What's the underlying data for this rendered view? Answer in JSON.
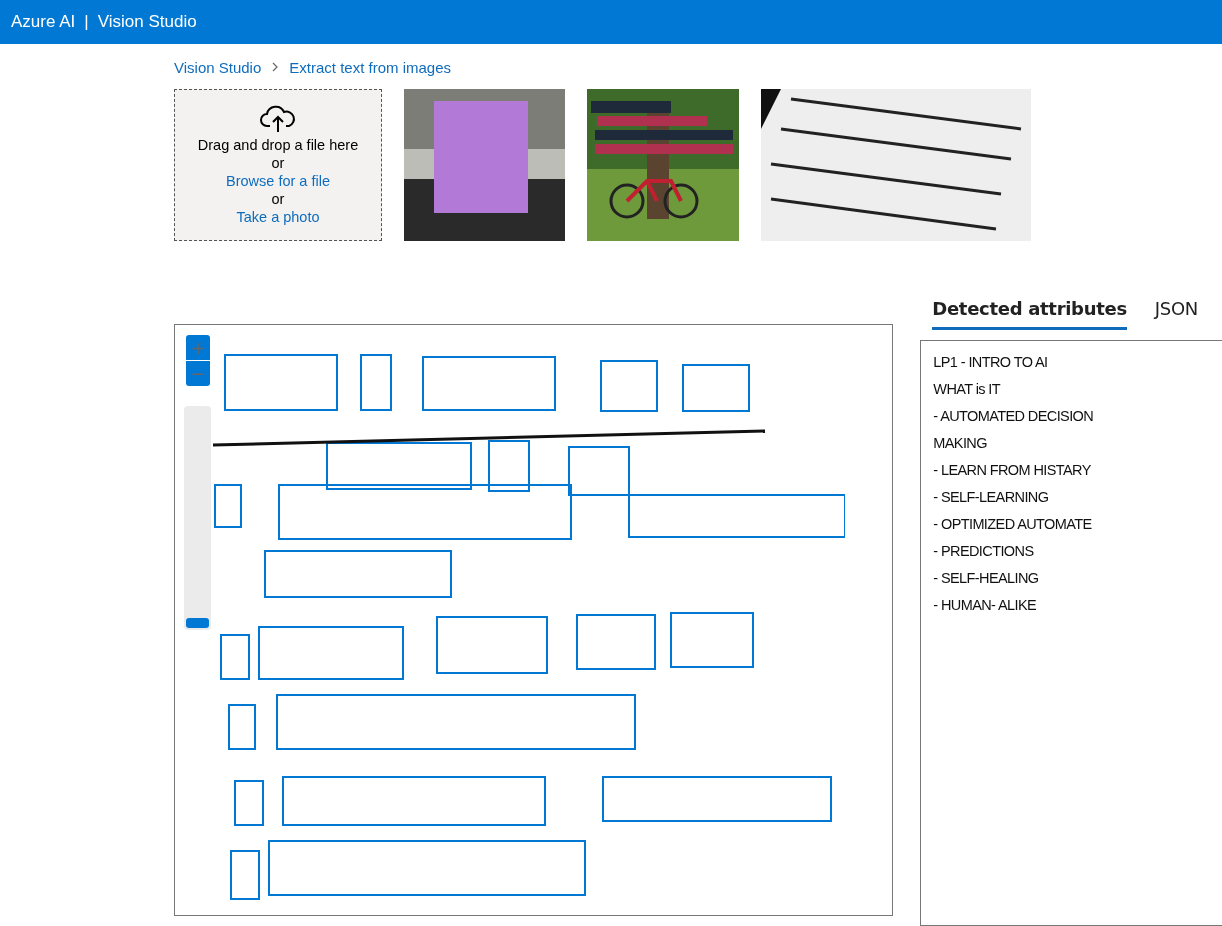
{
  "header": {
    "product": "Azure AI",
    "separator": "|",
    "title": "Vision Studio"
  },
  "breadcrumb": [
    {
      "label": "Vision Studio"
    },
    {
      "label": "Extract text from images"
    }
  ],
  "upload": {
    "prompt": "Drag and drop a file here",
    "or_1": "or",
    "browse": "Browse for a file",
    "or_2": "or",
    "photo": "Take a photo"
  },
  "samples": [
    {
      "kind": "note"
    },
    {
      "kind": "bicycle"
    },
    {
      "kind": "label"
    }
  ],
  "viewer": {
    "zoom_in": "+",
    "zoom_out": "−",
    "zoom": {
      "level": 0
    }
  },
  "tabs": [
    {
      "label": "Detected attributes",
      "selected": true
    },
    {
      "label": "JSON",
      "selected": false
    }
  ],
  "lines": [
    "LP1 - INTRO TO AI",
    "WHAT is IT",
    "- AUTOMATED DECISION",
    "MAKING",
    "- LEARN FROM HISTARY",
    "- SELF-LEARNING",
    "- OPTIMIZED AUTOMATE",
    "- PREDICTIONS",
    "- SELF-HEALING",
    "- HUMAN- ALIKE"
  ]
}
